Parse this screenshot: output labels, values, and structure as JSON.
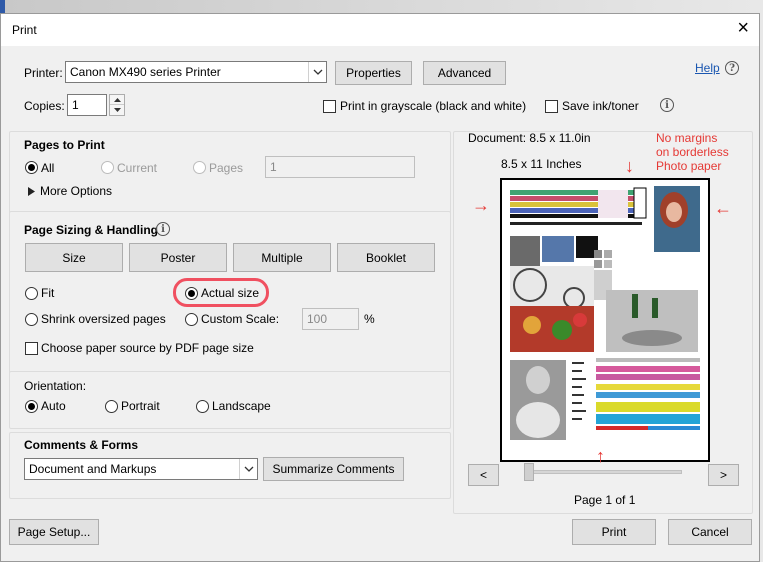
{
  "dialog": {
    "title": "Print",
    "close_glyph": "×"
  },
  "printer": {
    "label": "Printer:",
    "selected": "Canon MX490 series Printer",
    "properties_label": "Properties",
    "advanced_label": "Advanced",
    "help_label": "Help"
  },
  "copies": {
    "label": "Copies:",
    "value": "1"
  },
  "options": {
    "grayscale_label": "Print in grayscale (black and white)",
    "save_ink_label": "Save ink/toner"
  },
  "pages_to_print": {
    "title": "Pages to Print",
    "all_label": "All",
    "current_label": "Current",
    "pages_label": "Pages",
    "pages_value": "1",
    "more_options_label": "More Options"
  },
  "sizing": {
    "title": "Page Sizing & Handling",
    "size_label": "Size",
    "poster_label": "Poster",
    "multiple_label": "Multiple",
    "booklet_label": "Booklet",
    "fit_label": "Fit",
    "actual_size_label": "Actual size",
    "shrink_label": "Shrink oversized pages",
    "custom_scale_label": "Custom Scale:",
    "custom_scale_value": "100",
    "percent_label": "%",
    "paper_source_label": "Choose paper source by PDF page size"
  },
  "orientation": {
    "title": "Orientation:",
    "auto_label": "Auto",
    "portrait_label": "Portrait",
    "landscape_label": "Landscape"
  },
  "comments": {
    "title": "Comments & Forms",
    "selected": "Document and Markups",
    "summarize_label": "Summarize Comments"
  },
  "preview": {
    "document_size": "Document: 8.5 x 11.0in",
    "paper_size": "8.5 x 11 Inches",
    "annotation_line1": "No margins",
    "annotation_line2": "on borderless",
    "annotation_line3": "Photo paper",
    "prev_label": "<",
    "next_label": ">",
    "page_indicator": "Page 1 of 1"
  },
  "footer": {
    "page_setup_label": "Page Setup...",
    "print_label": "Print",
    "cancel_label": "Cancel"
  },
  "colors": {
    "accent_link": "#1a56b0",
    "annotation_red": "#e53935"
  }
}
